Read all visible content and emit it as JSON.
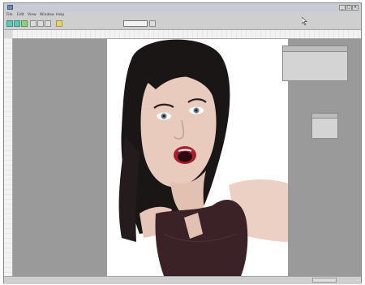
{
  "window": {
    "title": "",
    "controls": [
      "_",
      "□",
      "×"
    ]
  },
  "menu": {
    "items": [
      "File",
      "Edit",
      "View",
      "Window",
      "Help"
    ]
  },
  "toolbar": {
    "zoom_value": ""
  },
  "info_panel": {
    "title": "",
    "lines": [
      "",
      "",
      "",
      ""
    ]
  },
  "small_panel": {
    "rows": [
      "",
      "",
      ""
    ]
  },
  "status": {
    "left_text": ""
  },
  "colors": {
    "workspace": "#9a9a9a",
    "chrome": "#cfcfcf",
    "canvas": "#ffffff"
  }
}
